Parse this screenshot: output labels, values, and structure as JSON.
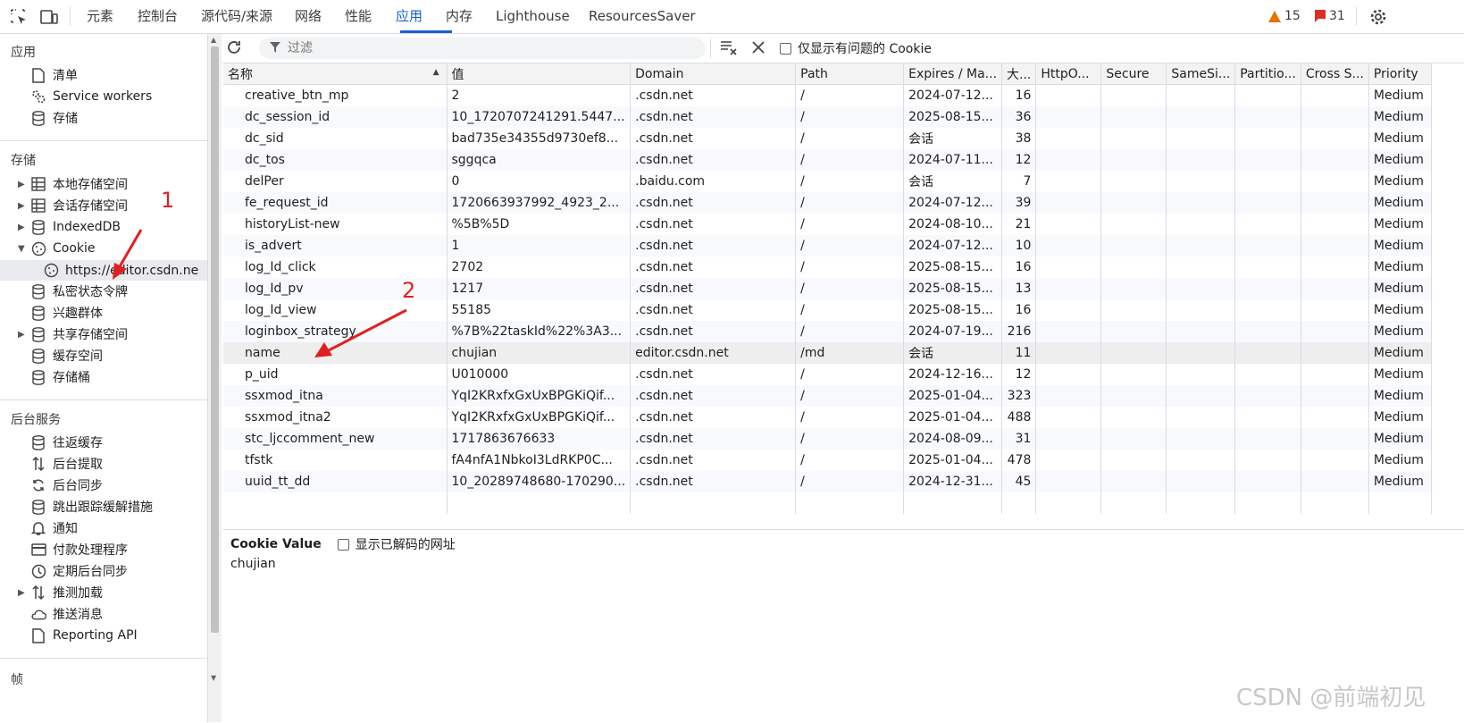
{
  "devtools": {
    "tabs": [
      "元素",
      "控制台",
      "源代码/来源",
      "网络",
      "性能",
      "应用",
      "内存",
      "Lighthouse",
      "ResourcesSaver"
    ],
    "active_tab": "应用",
    "warnings_count": "15",
    "issues_count": "31"
  },
  "sidebar": {
    "app_section": "应用",
    "app_items": [
      "清单",
      "Service workers",
      "存储"
    ],
    "storage_section": "存储",
    "storage_items": [
      "本地存储空间",
      "会话存储空间",
      "IndexedDB",
      "Cookie",
      "https://editor.csdn.ne",
      "私密状态令牌",
      "兴趣群体",
      "共享存储空间",
      "缓存空间",
      "存储桶"
    ],
    "bg_section": "后台服务",
    "bg_items": [
      "往返缓存",
      "后台提取",
      "后台同步",
      "跳出跟踪缓解措施",
      "通知",
      "付款处理程序",
      "定期后台同步",
      "推测加载",
      "推送消息",
      "Reporting API"
    ],
    "frames_section": "帧"
  },
  "toolbar": {
    "filter_placeholder": "过滤",
    "only_issues_label": "仅显示有问题的 Cookie"
  },
  "table": {
    "headers": [
      "名称",
      "值",
      "Domain",
      "Path",
      "Expires / Ma...",
      "大...",
      "HttpO...",
      "Secure",
      "SameSi...",
      "Partitio...",
      "Cross S...",
      "Priority"
    ],
    "rows": [
      [
        "creative_btn_mp",
        "2",
        ".csdn.net",
        "/",
        "2024-07-12...",
        "16",
        "Medium"
      ],
      [
        "dc_session_id",
        "10_1720707241291.5447...",
        ".csdn.net",
        "/",
        "2025-08-15...",
        "36",
        "Medium"
      ],
      [
        "dc_sid",
        "bad735e34355d9730ef8...",
        ".csdn.net",
        "/",
        "会话",
        "38",
        "Medium"
      ],
      [
        "dc_tos",
        "sggqca",
        ".csdn.net",
        "/",
        "2024-07-11...",
        "12",
        "Medium"
      ],
      [
        "delPer",
        "0",
        ".baidu.com",
        "/",
        "会话",
        "7",
        "Medium"
      ],
      [
        "fe_request_id",
        "1720663937992_4923_2...",
        ".csdn.net",
        "/",
        "2024-07-12...",
        "39",
        "Medium"
      ],
      [
        "historyList-new",
        "%5B%5D",
        ".csdn.net",
        "/",
        "2024-08-10...",
        "21",
        "Medium"
      ],
      [
        "is_advert",
        "1",
        ".csdn.net",
        "/",
        "2024-07-12...",
        "10",
        "Medium"
      ],
      [
        "log_Id_click",
        "2702",
        ".csdn.net",
        "/",
        "2025-08-15...",
        "16",
        "Medium"
      ],
      [
        "log_Id_pv",
        "1217",
        ".csdn.net",
        "/",
        "2025-08-15...",
        "13",
        "Medium"
      ],
      [
        "log_Id_view",
        "55185",
        ".csdn.net",
        "/",
        "2025-08-15...",
        "16",
        "Medium"
      ],
      [
        "loginbox_strategy",
        "%7B%22taskId%22%3A3...",
        ".csdn.net",
        "/",
        "2024-07-19...",
        "216",
        "Medium"
      ],
      [
        "name",
        "chujian",
        "editor.csdn.net",
        "/md",
        "会话",
        "11",
        "Medium"
      ],
      [
        "p_uid",
        "U010000",
        ".csdn.net",
        "/",
        "2024-12-16...",
        "12",
        "Medium"
      ],
      [
        "ssxmod_itna",
        "YqI2KRxfxGxUxBPGKiQif...",
        ".csdn.net",
        "/",
        "2025-01-04...",
        "323",
        "Medium"
      ],
      [
        "ssxmod_itna2",
        "YqI2KRxfxGxUxBPGKiQif...",
        ".csdn.net",
        "/",
        "2025-01-04...",
        "488",
        "Medium"
      ],
      [
        "stc_ljccomment_new",
        "1717863676633",
        ".csdn.net",
        "/",
        "2024-08-09...",
        "31",
        "Medium"
      ],
      [
        "tfstk",
        "fA4nfA1NbkoI3LdRKP0C...",
        ".csdn.net",
        "/",
        "2025-01-04...",
        "478",
        "Medium"
      ],
      [
        "uuid_tt_dd",
        "10_20289748680-170290...",
        ".csdn.net",
        "/",
        "2024-12-31...",
        "45",
        "Medium"
      ]
    ]
  },
  "detail": {
    "title": "Cookie Value",
    "decode_label": "显示已解码的网址",
    "value": "chujian"
  },
  "annotations": {
    "label1": "1",
    "label2": "2"
  },
  "watermark": "CSDN @前端初见",
  "colors": {
    "accent": "#1a5fd0",
    "annotation": "#e02020",
    "warning": "#e37400",
    "issue": "#d93025"
  }
}
